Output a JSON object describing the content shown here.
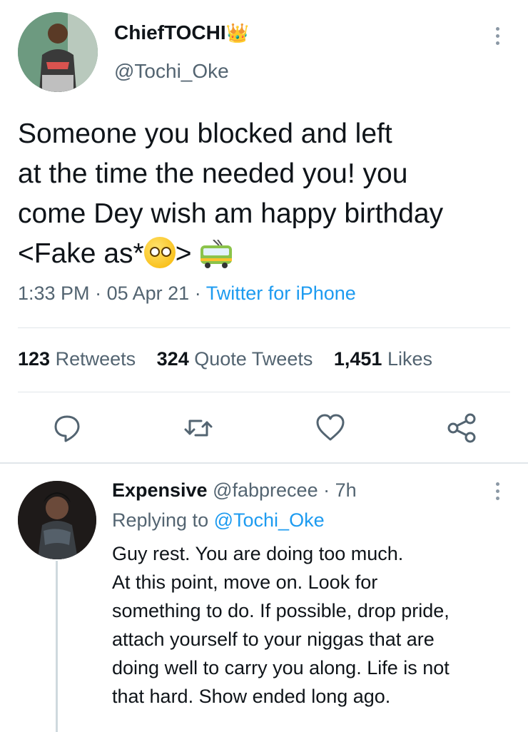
{
  "tweet": {
    "display_name": "ChiefTOCHI",
    "crown_emoji": "👑",
    "handle": "@Tochi_Oke",
    "text_lines": [
      "Someone you blocked and left",
      "at the time the needed you! you",
      "come Dey wish am happy birthday"
    ],
    "text_last_prefix": "<Fake as*",
    "text_last_suffix": ">",
    "time": "1:33 PM",
    "date": "05 Apr 21",
    "sep": "·",
    "source": "Twitter for iPhone"
  },
  "stats": {
    "retweets_count": "123",
    "retweets_label": "Retweets",
    "quotes_count": "324",
    "quotes_label": "Quote Tweets",
    "likes_count": "1,451",
    "likes_label": "Likes"
  },
  "actions": [
    "reply-icon",
    "retweet-icon",
    "like-icon",
    "share-icon"
  ],
  "reply": {
    "display_name": "Expensive",
    "handle": "@fabprecee",
    "sep": "·",
    "age": "7h",
    "replying_prefix": "Replying to",
    "replying_to": "@Tochi_Oke",
    "text_lines": [
      "Guy rest. You are doing too much.",
      "At this point, move on. Look for",
      "something to do. If possible,  drop pride,",
      "attach yourself to your niggas  that are",
      "doing well to carry you along. Life is not",
      "that hard. Show ended long ago."
    ]
  },
  "colors": {
    "link": "#1d9bf0",
    "secondary_text": "#536471",
    "primary_text": "#0f1419"
  }
}
